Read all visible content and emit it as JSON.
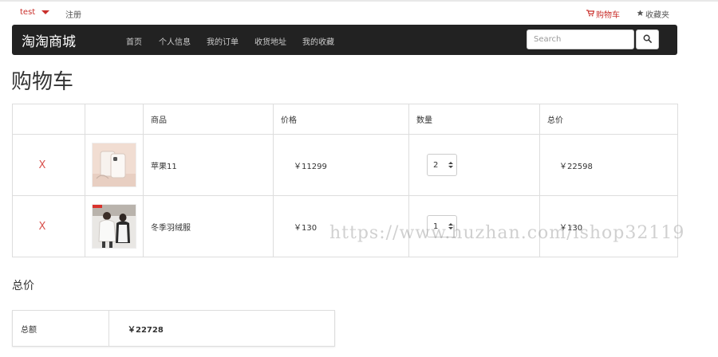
{
  "topbar": {
    "username": "test",
    "register_label": "注册",
    "cart_label": "购物车",
    "favorites_label": "收藏夹"
  },
  "navbar": {
    "brand": "淘淘商城",
    "items": [
      {
        "label": "首页"
      },
      {
        "label": "个人信息"
      },
      {
        "label": "我的订单"
      },
      {
        "label": "收货地址"
      },
      {
        "label": "我的收藏"
      }
    ],
    "search_placeholder": "Search"
  },
  "page_title": "购物车",
  "cart": {
    "headers": [
      "",
      "",
      "商品",
      "价格",
      "数量",
      "总价"
    ],
    "rows": [
      {
        "remove_label": "X",
        "image": "phone-product-image",
        "name": "苹果11",
        "price": "￥11299",
        "quantity": "2",
        "total": "￥22598"
      },
      {
        "remove_label": "X",
        "image": "down-jacket-product-image",
        "name": "冬季羽绒服",
        "price": "￥130",
        "quantity": "1",
        "total": "￥130"
      }
    ]
  },
  "summary": {
    "title": "总价",
    "label": "总额",
    "value": "￥22728"
  },
  "watermark": "https://www.huzhan.com/ishop32119",
  "colors": {
    "accent_red": "#c9302c",
    "navbar_bg": "#222222",
    "border": "#dddddd"
  },
  "icons": [
    "caret-down-icon",
    "cart-icon",
    "star-icon",
    "search-icon",
    "remove-icon"
  ]
}
